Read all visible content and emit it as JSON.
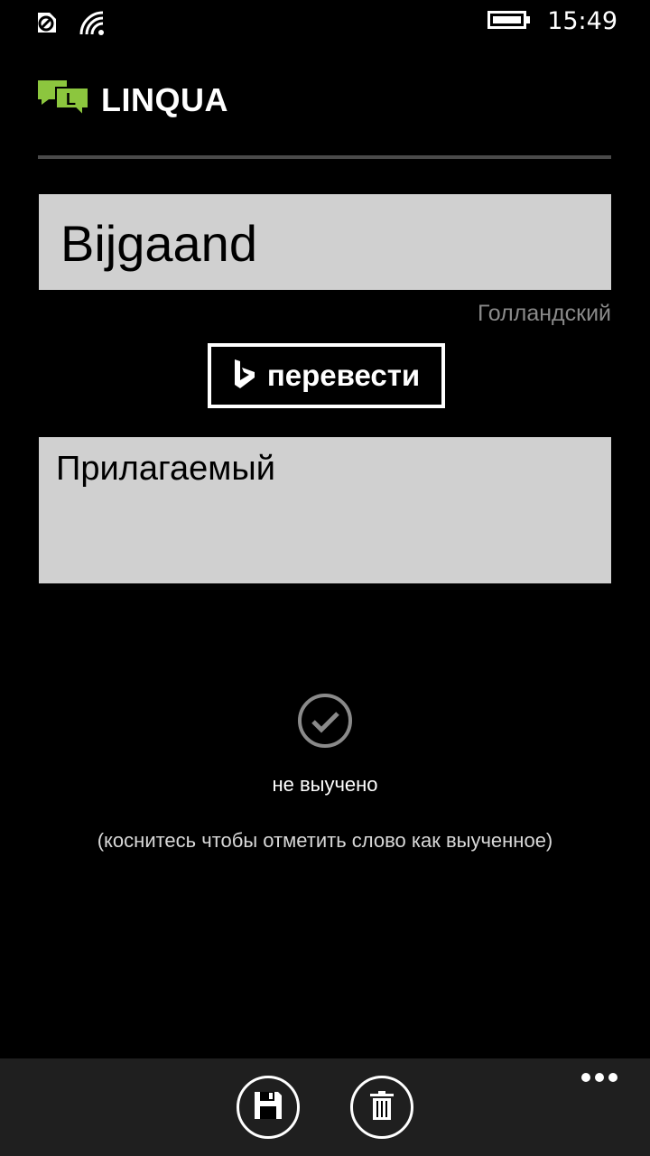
{
  "status_bar": {
    "time": "15:49",
    "icons": [
      "data-sense-icon",
      "wifi-icon",
      "battery-icon"
    ]
  },
  "header": {
    "app_name": "LINQUA",
    "logo_letter": "L",
    "logo_colors": [
      "#8cc63e",
      "#5a8a22"
    ]
  },
  "word": {
    "value": "Bijgaand",
    "language": "Голландский"
  },
  "translate_button": {
    "label": "перевести",
    "icon": "bing-icon"
  },
  "translation": {
    "value": "Прилагаемый"
  },
  "learned_status": {
    "icon": "check-circle-icon",
    "label": "не выучено",
    "hint": "(коснитесь чтобы отметить слово как выученное)"
  },
  "app_bar": {
    "buttons": [
      {
        "icon": "save-icon"
      },
      {
        "icon": "delete-icon"
      }
    ],
    "more_icon": "more-icon"
  },
  "colors": {
    "background": "#000000",
    "field_background": "#d0d0d0",
    "app_bar_background": "#1f1f1f",
    "secondary_text": "#8a8a8a",
    "accent_green": "#8cc63e"
  }
}
